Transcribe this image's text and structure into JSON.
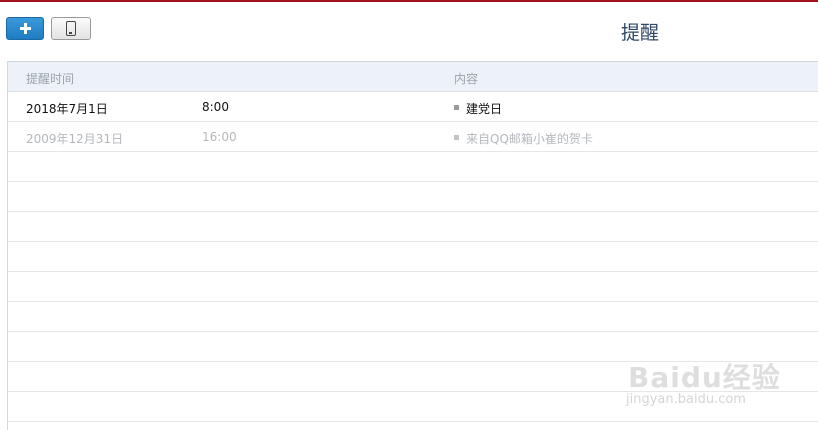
{
  "toolbar": {
    "add_icon": "plus-icon",
    "phone_icon": "mobile-phone-icon"
  },
  "page": {
    "title": "提醒"
  },
  "table": {
    "columns": [
      "提醒时间",
      "内容"
    ],
    "rows": [
      {
        "date": "2018年7月1日",
        "time": "8:00",
        "content": "建党日",
        "state": "active"
      },
      {
        "date": "2009年12月31日",
        "time": "16:00",
        "content": "来自QQ邮箱小崔的贺卡",
        "state": "past"
      }
    ]
  },
  "watermark": {
    "logo": "Baidu经验",
    "url": "jingyan.baidu.com"
  },
  "colors": {
    "accent_top": "#a0141e",
    "add_button": "#1f7cc1",
    "title": "#2f4868",
    "header_bg": "#edf2f8"
  }
}
